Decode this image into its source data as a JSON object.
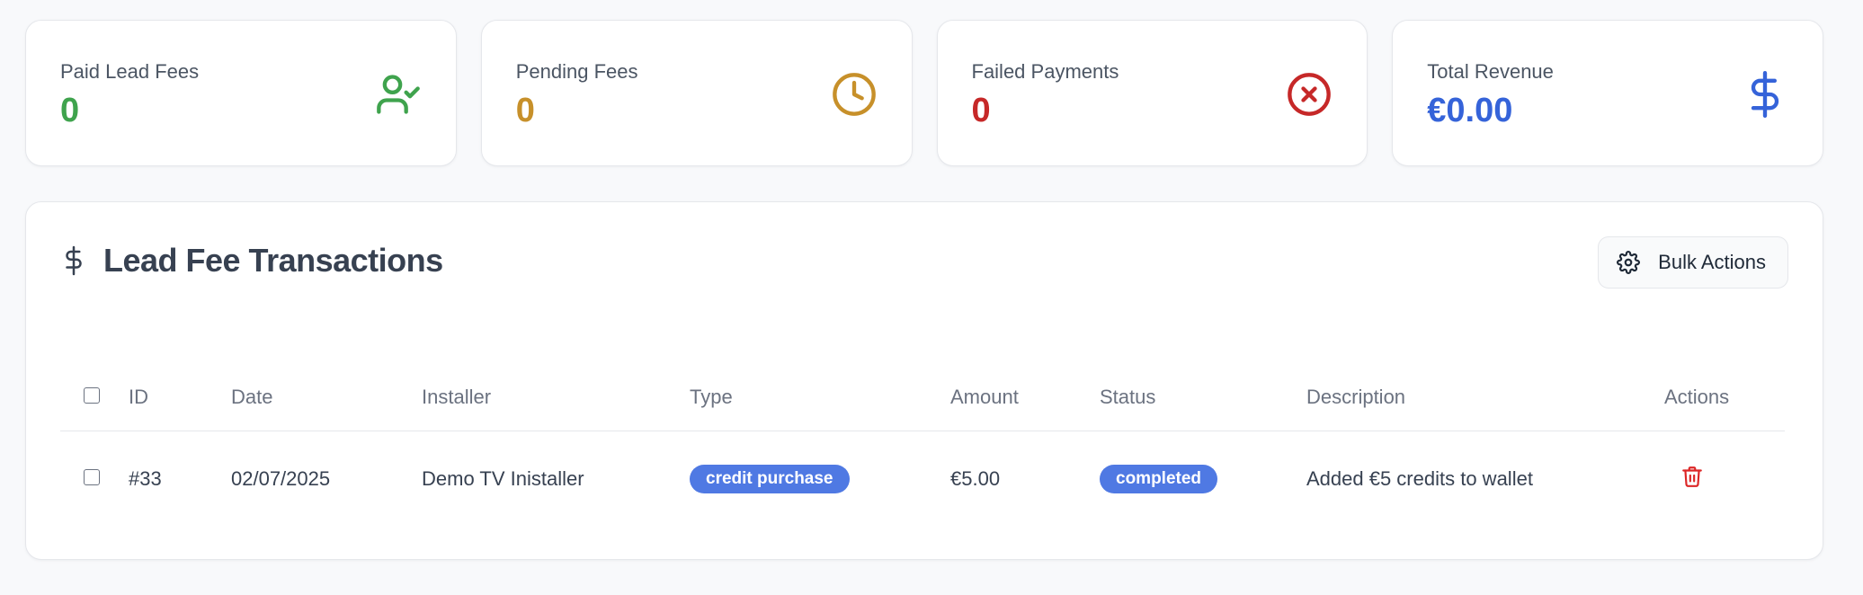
{
  "stats": [
    {
      "label": "Paid Lead Fees",
      "value": "0",
      "color": "#3fa34d",
      "icon": "user-check-icon"
    },
    {
      "label": "Pending Fees",
      "value": "0",
      "color": "#c7902a",
      "icon": "clock-icon"
    },
    {
      "label": "Failed Payments",
      "value": "0",
      "color": "#c62828",
      "icon": "x-circle-icon"
    },
    {
      "label": "Total Revenue",
      "value": "€0.00",
      "color": "#3563d9",
      "icon": "dollar-icon"
    }
  ],
  "panel": {
    "title": "Lead Fee Transactions",
    "title_icon": "dollar-icon",
    "bulk_actions_label": "Bulk Actions",
    "bulk_actions_icon": "gear-icon"
  },
  "table": {
    "headers": [
      "",
      "ID",
      "Date",
      "Installer",
      "Type",
      "Amount",
      "Status",
      "Description",
      "Actions"
    ],
    "rows": [
      {
        "id": "#33",
        "date": "02/07/2025",
        "installer": "Demo TV Inistaller",
        "type": "credit purchase",
        "amount": "€5.00",
        "status": "completed",
        "description": "Added €5 credits to wallet",
        "action_icon": "trash-icon"
      }
    ]
  },
  "colors": {
    "accent": "#4f79e3",
    "amount": "#2f9e44",
    "delete": "#dc2626"
  }
}
